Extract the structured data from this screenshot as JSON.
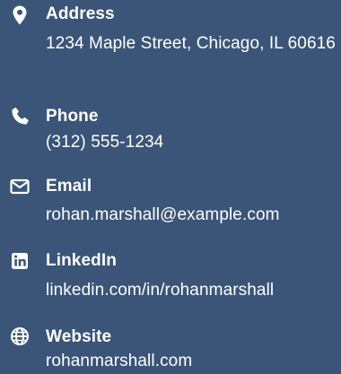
{
  "contact": {
    "items": [
      {
        "icon": "map-marker-icon",
        "label": "Address",
        "value": "1234 Maple Street, Chicago, IL 60616"
      },
      {
        "icon": "phone-icon",
        "label": "Phone",
        "value": "(312) 555-1234"
      },
      {
        "icon": "envelope-icon",
        "label": "Email",
        "value": "rohan.marshall@example.com"
      },
      {
        "icon": "linkedin-icon",
        "label": "LinkedIn",
        "value": "linkedin.com/in/rohanmarshall"
      },
      {
        "icon": "globe-icon",
        "label": "Website",
        "value": "rohanmarshall.com"
      }
    ]
  },
  "colors": {
    "background": "#3a5577",
    "text": "#ffffff"
  }
}
